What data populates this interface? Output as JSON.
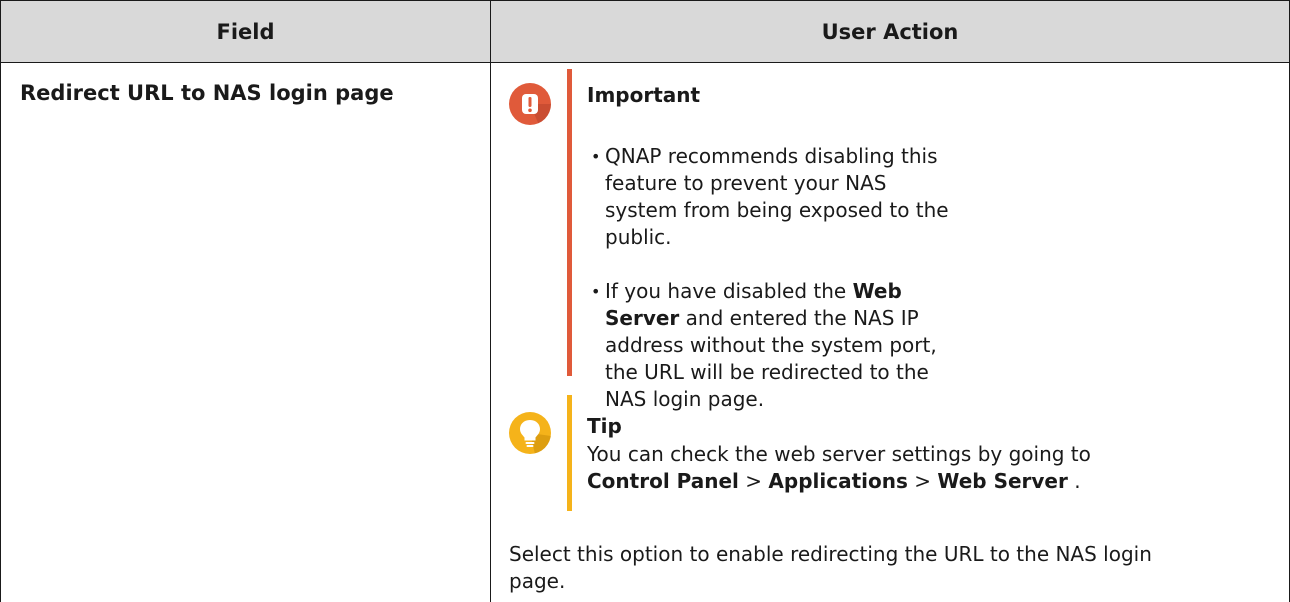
{
  "table": {
    "headers": [
      "Field",
      "User Action"
    ],
    "field": "Redirect URL to NAS login page"
  },
  "important": {
    "title": "Important",
    "bullet1": "QNAP recommends disabling this feature to prevent your NAS system from being exposed to the public.",
    "bullet2_prefix": "If you have disabled the ",
    "bullet2_bold": "Web Server",
    "bullet2_suffix": " and entered the NAS IP address without the system port, the URL will be redirected to the NAS login page.",
    "color": "#e05a3a",
    "icon": "exclamation-icon"
  },
  "tip": {
    "title": "Tip",
    "text": "You can check the web server settings by going to",
    "path": [
      "Control Panel",
      "Applications",
      "Web Server"
    ],
    "separator": ">",
    "end": ".",
    "color": "#f5b31a",
    "icon": "lightbulb-icon"
  },
  "description": "Select this option to enable redirecting the URL to the NAS login page."
}
